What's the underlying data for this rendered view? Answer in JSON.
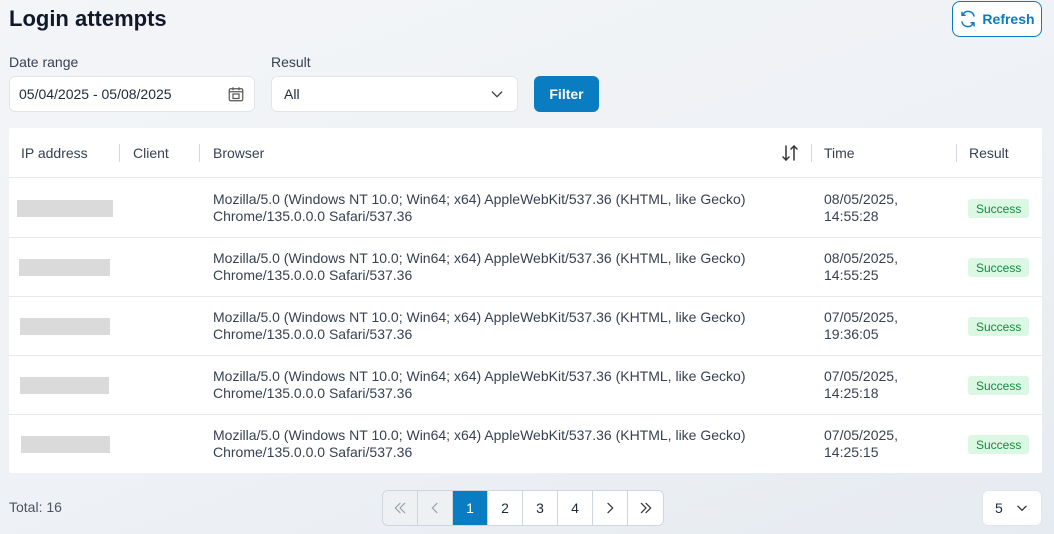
{
  "page": {
    "title": "Login attempts"
  },
  "toolbar": {
    "refresh_label": "Refresh"
  },
  "filters": {
    "date_label": "Date range",
    "date_value": "05/04/2025 - 05/08/2025",
    "result_label": "Result",
    "result_value": "All",
    "filter_label": "Filter"
  },
  "table": {
    "headers": {
      "ip": "IP address",
      "client": "Client",
      "browser": "Browser",
      "time": "Time",
      "result": "Result"
    },
    "rows": [
      {
        "browser_line1": "Mozilla/5.0 (Windows NT 10.0; Win64; x64) AppleWebKit/537.36 (KHTML, like Gecko)",
        "browser_line2": "Chrome/135.0.0.0 Safari/537.36",
        "time_line1": "08/05/2025,",
        "time_line2": "14:55:28",
        "result": "Success"
      },
      {
        "browser_line1": "Mozilla/5.0 (Windows NT 10.0; Win64; x64) AppleWebKit/537.36 (KHTML, like Gecko)",
        "browser_line2": "Chrome/135.0.0.0 Safari/537.36",
        "time_line1": "08/05/2025,",
        "time_line2": "14:55:25",
        "result": "Success"
      },
      {
        "browser_line1": "Mozilla/5.0 (Windows NT 10.0; Win64; x64) AppleWebKit/537.36 (KHTML, like Gecko)",
        "browser_line2": "Chrome/135.0.0.0 Safari/537.36",
        "time_line1": "07/05/2025,",
        "time_line2": "19:36:05",
        "result": "Success"
      },
      {
        "browser_line1": "Mozilla/5.0 (Windows NT 10.0; Win64; x64) AppleWebKit/537.36 (KHTML, like Gecko)",
        "browser_line2": "Chrome/135.0.0.0 Safari/537.36",
        "time_line1": "07/05/2025,",
        "time_line2": "14:25:18",
        "result": "Success"
      },
      {
        "browser_line1": "Mozilla/5.0 (Windows NT 10.0; Win64; x64) AppleWebKit/537.36 (KHTML, like Gecko)",
        "browser_line2": "Chrome/135.0.0.0 Safari/537.36",
        "time_line1": "07/05/2025,",
        "time_line2": "14:25:15",
        "result": "Success"
      }
    ]
  },
  "footer": {
    "total": "Total: 16",
    "pages": [
      "1",
      "2",
      "3",
      "4"
    ],
    "current_page": "1",
    "page_size": "5"
  },
  "colors": {
    "accent": "#0a7cc1",
    "success_bg": "#dcf7e3",
    "success_text": "#138a3e"
  },
  "icons": {
    "refresh": "refresh-icon",
    "calendar": "calendar-icon",
    "dropdown": "chevron-down-icon",
    "sort": "sort-icon",
    "first": "double-chevron-left-icon",
    "prev": "chevron-left-icon",
    "next": "chevron-right-icon",
    "last": "double-chevron-right-icon"
  }
}
